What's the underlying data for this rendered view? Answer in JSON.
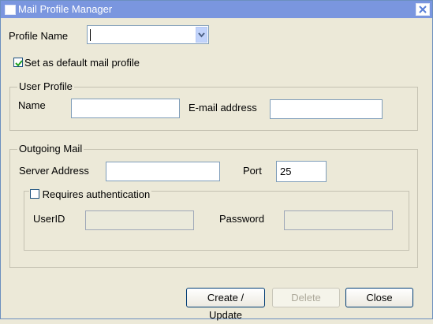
{
  "window": {
    "title": "Mail Profile Manager",
    "title_bar_color": "#7a96df",
    "icons": [
      "window-icon",
      "close-icon"
    ]
  },
  "profile": {
    "name_label": "Profile Name",
    "name_value": "",
    "default_label": "Set as default mail profile",
    "default_checked": true
  },
  "user_profile": {
    "legend": "User Profile",
    "name_label": "Name",
    "name_value": "",
    "email_label": "E-mail address",
    "email_value": ""
  },
  "outgoing": {
    "legend": "Outgoing Mail",
    "server_label": "Server Address",
    "server_value": "",
    "port_label": "Port",
    "port_value": "25",
    "auth_label": "Requires authentication",
    "auth_checked": false,
    "userid_label": "UserID",
    "userid_value": "",
    "password_label": "Password",
    "password_value": ""
  },
  "buttons": {
    "create_update": "Create / Update",
    "delete": "Delete",
    "close": "Close"
  }
}
